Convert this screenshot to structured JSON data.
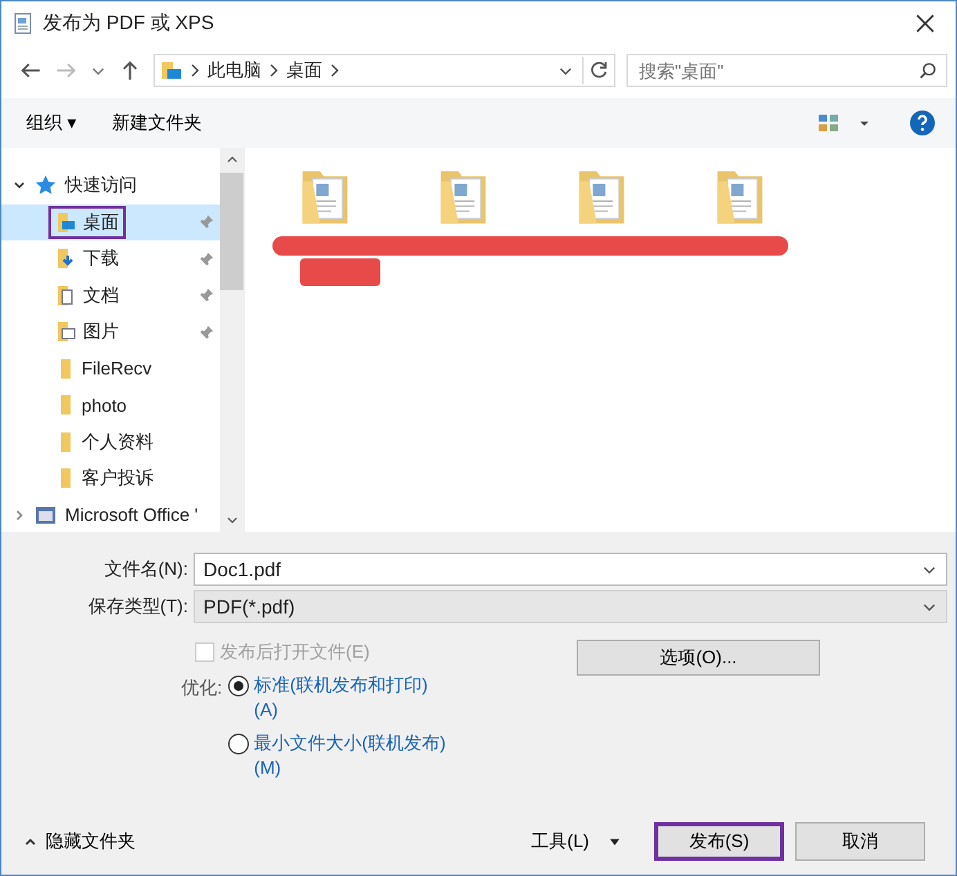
{
  "window": {
    "title": "发布为 PDF 或 XPS"
  },
  "address": {
    "path": [
      "此电脑",
      "桌面"
    ],
    "search_placeholder": "搜索\"桌面\""
  },
  "toolbar": {
    "organize": "组织 ▾",
    "new_folder": "新建文件夹"
  },
  "nav": [
    {
      "label": "快速访问",
      "kind": "star",
      "expanded": true,
      "children": [
        {
          "label": "桌面",
          "kind": "desktop",
          "pinned": true,
          "selected": true,
          "highlighted": true
        },
        {
          "label": "下载",
          "kind": "download",
          "pinned": true,
          "selected": false,
          "highlighted": false
        },
        {
          "label": "文档",
          "kind": "docs",
          "pinned": true,
          "selected": false,
          "highlighted": false
        },
        {
          "label": "图片",
          "kind": "pics",
          "pinned": true,
          "selected": false,
          "highlighted": false
        },
        {
          "label": "FileRecv",
          "kind": "folder",
          "pinned": false,
          "selected": false,
          "highlighted": false
        },
        {
          "label": "photo",
          "kind": "folder",
          "pinned": false,
          "selected": false,
          "highlighted": false
        },
        {
          "label": "个人资料",
          "kind": "folder",
          "pinned": false,
          "selected": false,
          "highlighted": false
        },
        {
          "label": "客户投诉",
          "kind": "folder",
          "pinned": false,
          "selected": false,
          "highlighted": false
        }
      ]
    },
    {
      "label": "Microsoft Office '",
      "kind": "office",
      "expanded": false
    }
  ],
  "files": [
    {
      "kind": "folder"
    },
    {
      "kind": "folder"
    },
    {
      "kind": "folder"
    },
    {
      "kind": "folder"
    }
  ],
  "form": {
    "filename_label": "文件名(N):",
    "filename": "Doc1.pdf",
    "type_label": "保存类型(T):",
    "type": "PDF(*.pdf)"
  },
  "open_after": {
    "label": "发布后打开文件(E)",
    "checked": false,
    "disabled": true
  },
  "optimize": {
    "label": "优化:",
    "options": [
      {
        "label": "标准(联机发布和打印)(A)",
        "selected": true
      },
      {
        "label": "最小文件大小(联机发布)(M)",
        "selected": false
      }
    ]
  },
  "options_button": "选项(O)...",
  "hide_folders": "隐藏文件夹",
  "tools": "工具(L)",
  "buttons": [
    {
      "label": "发布(S)",
      "highlighted": true
    },
    {
      "label": "取消",
      "highlighted": false
    }
  ]
}
